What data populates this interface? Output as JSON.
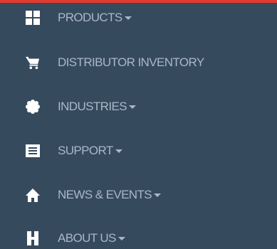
{
  "menu": {
    "accent_color": "#e23a2c",
    "background_color": "#364a5e",
    "text_color": "#a9b7c8",
    "icon_color": "#ffffff",
    "items": [
      {
        "label": "PRODUCTS",
        "icon": "grid-icon",
        "has_dropdown": true
      },
      {
        "label": "DISTRIBUTOR INVENTORY",
        "icon": "cart-icon",
        "has_dropdown": false
      },
      {
        "label": "INDUSTRIES",
        "icon": "gear-icon",
        "has_dropdown": true
      },
      {
        "label": "SUPPORT",
        "icon": "list-icon",
        "has_dropdown": true
      },
      {
        "label": "NEWS & EVENTS",
        "icon": "home-icon",
        "has_dropdown": true
      },
      {
        "label": "ABOUT US",
        "icon": "h-letter-icon",
        "has_dropdown": true
      }
    ]
  }
}
